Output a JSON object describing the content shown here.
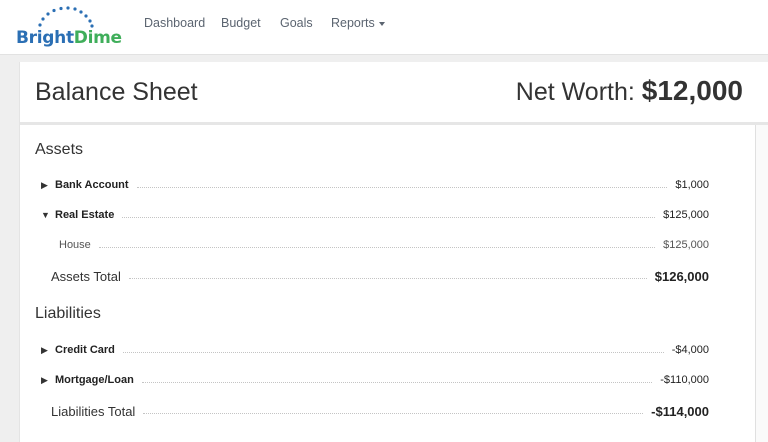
{
  "brand": {
    "part1": "Bright",
    "part2": "Dime"
  },
  "nav": {
    "dashboard": "Dashboard",
    "budget": "Budget",
    "goals": "Goals",
    "reports": "Reports"
  },
  "header": {
    "title": "Balance Sheet",
    "net_worth_label": "Net Worth:",
    "net_worth_value": "$12,000"
  },
  "assets": {
    "title": "Assets",
    "items": [
      {
        "label": "Bank Account",
        "amount": "$1,000",
        "expanded": false
      },
      {
        "label": "Real Estate",
        "amount": "$125,000",
        "expanded": true,
        "children": [
          {
            "label": "House",
            "amount": "$125,000"
          }
        ]
      }
    ],
    "total_label": "Assets Total",
    "total_amount": "$126,000"
  },
  "liabilities": {
    "title": "Liabilities",
    "items": [
      {
        "label": "Credit Card",
        "amount": "-$4,000",
        "expanded": false
      },
      {
        "label": "Mortgage/Loan",
        "amount": "-$110,000",
        "expanded": false
      }
    ],
    "total_label": "Liabilities Total",
    "total_amount": "-$114,000"
  },
  "icons": {
    "collapsed": "triangle-right-icon",
    "expanded": "triangle-down-icon"
  },
  "colors": {
    "brand_blue": "#2b6fb4",
    "brand_green": "#3fae5a"
  }
}
